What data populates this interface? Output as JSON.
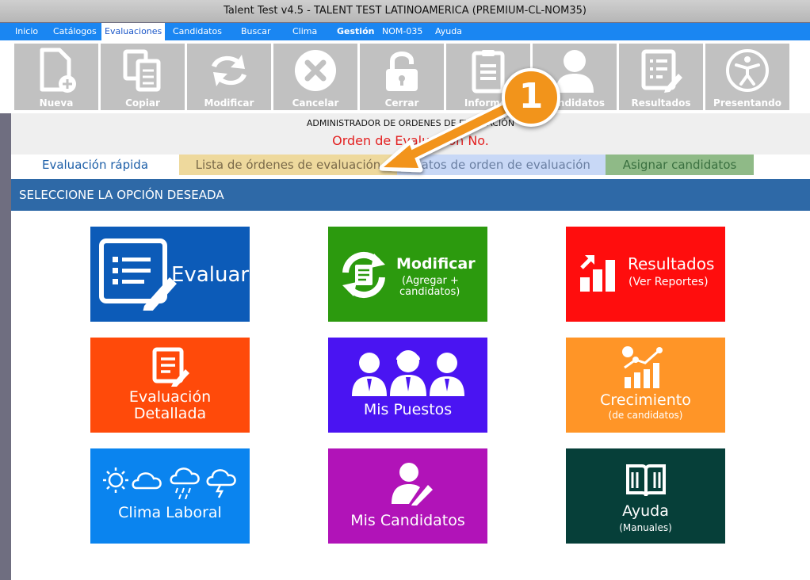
{
  "window": {
    "title": "Talent Test v4.5 - TALENT TEST LATINOAMERICA (PREMIUM-CL-NOM35)"
  },
  "menu": [
    "Inicio",
    "Catálogos",
    "Evaluaciones",
    "Candidatos",
    "Buscar",
    "Clima",
    "Gestión",
    "NOM-035",
    "Ayuda"
  ],
  "menu_active": "Evaluaciones",
  "toolbar": [
    "Nueva",
    "Copiar",
    "Modificar",
    "Cancelar",
    "Cerrar",
    "Informes",
    "Candidatos",
    "Resultados",
    "Presentando"
  ],
  "header": {
    "admin_title": "ADMINISTRADOR DE ORDENES DE EVALUACIÓN",
    "orden": "Orden de Evaluación No."
  },
  "tabs": [
    "Evaluación rápida",
    "Lista de órdenes de evaluación",
    "Datos de orden de evaluación",
    "Asignar candidatos"
  ],
  "section_title": "SELECCIONE LA OPCIÓN DESEADA",
  "tiles": {
    "evaluar": {
      "label": "Evaluar",
      "color": "#0c5bb8"
    },
    "modificar": {
      "label": "Modificar",
      "sub1": "(Agregar +",
      "sub2": "candidatos)",
      "color": "#2c9a0e"
    },
    "resultados": {
      "label": "Resultados",
      "sub": "(Ver Reportes)",
      "color": "#ff0d0d"
    },
    "evaluacion_detallada": {
      "line1": "Evaluación",
      "line2": "Detallada",
      "color": "#ff4a0a"
    },
    "mis_puestos": {
      "label": "Mis Puestos",
      "color": "#4a14f2"
    },
    "crecimiento": {
      "label": "Crecimiento",
      "sub": "(de candidatos)",
      "color": "#ff9527"
    },
    "clima_laboral": {
      "label": "Clima Laboral",
      "color": "#0a84ef"
    },
    "mis_candidatos": {
      "label": "Mis Candidatos",
      "color": "#b113b8"
    },
    "ayuda": {
      "label": "Ayuda",
      "sub": "(Manuales)",
      "color": "#063f39"
    }
  },
  "annotation": {
    "number": "1",
    "color": "#f2941b"
  }
}
